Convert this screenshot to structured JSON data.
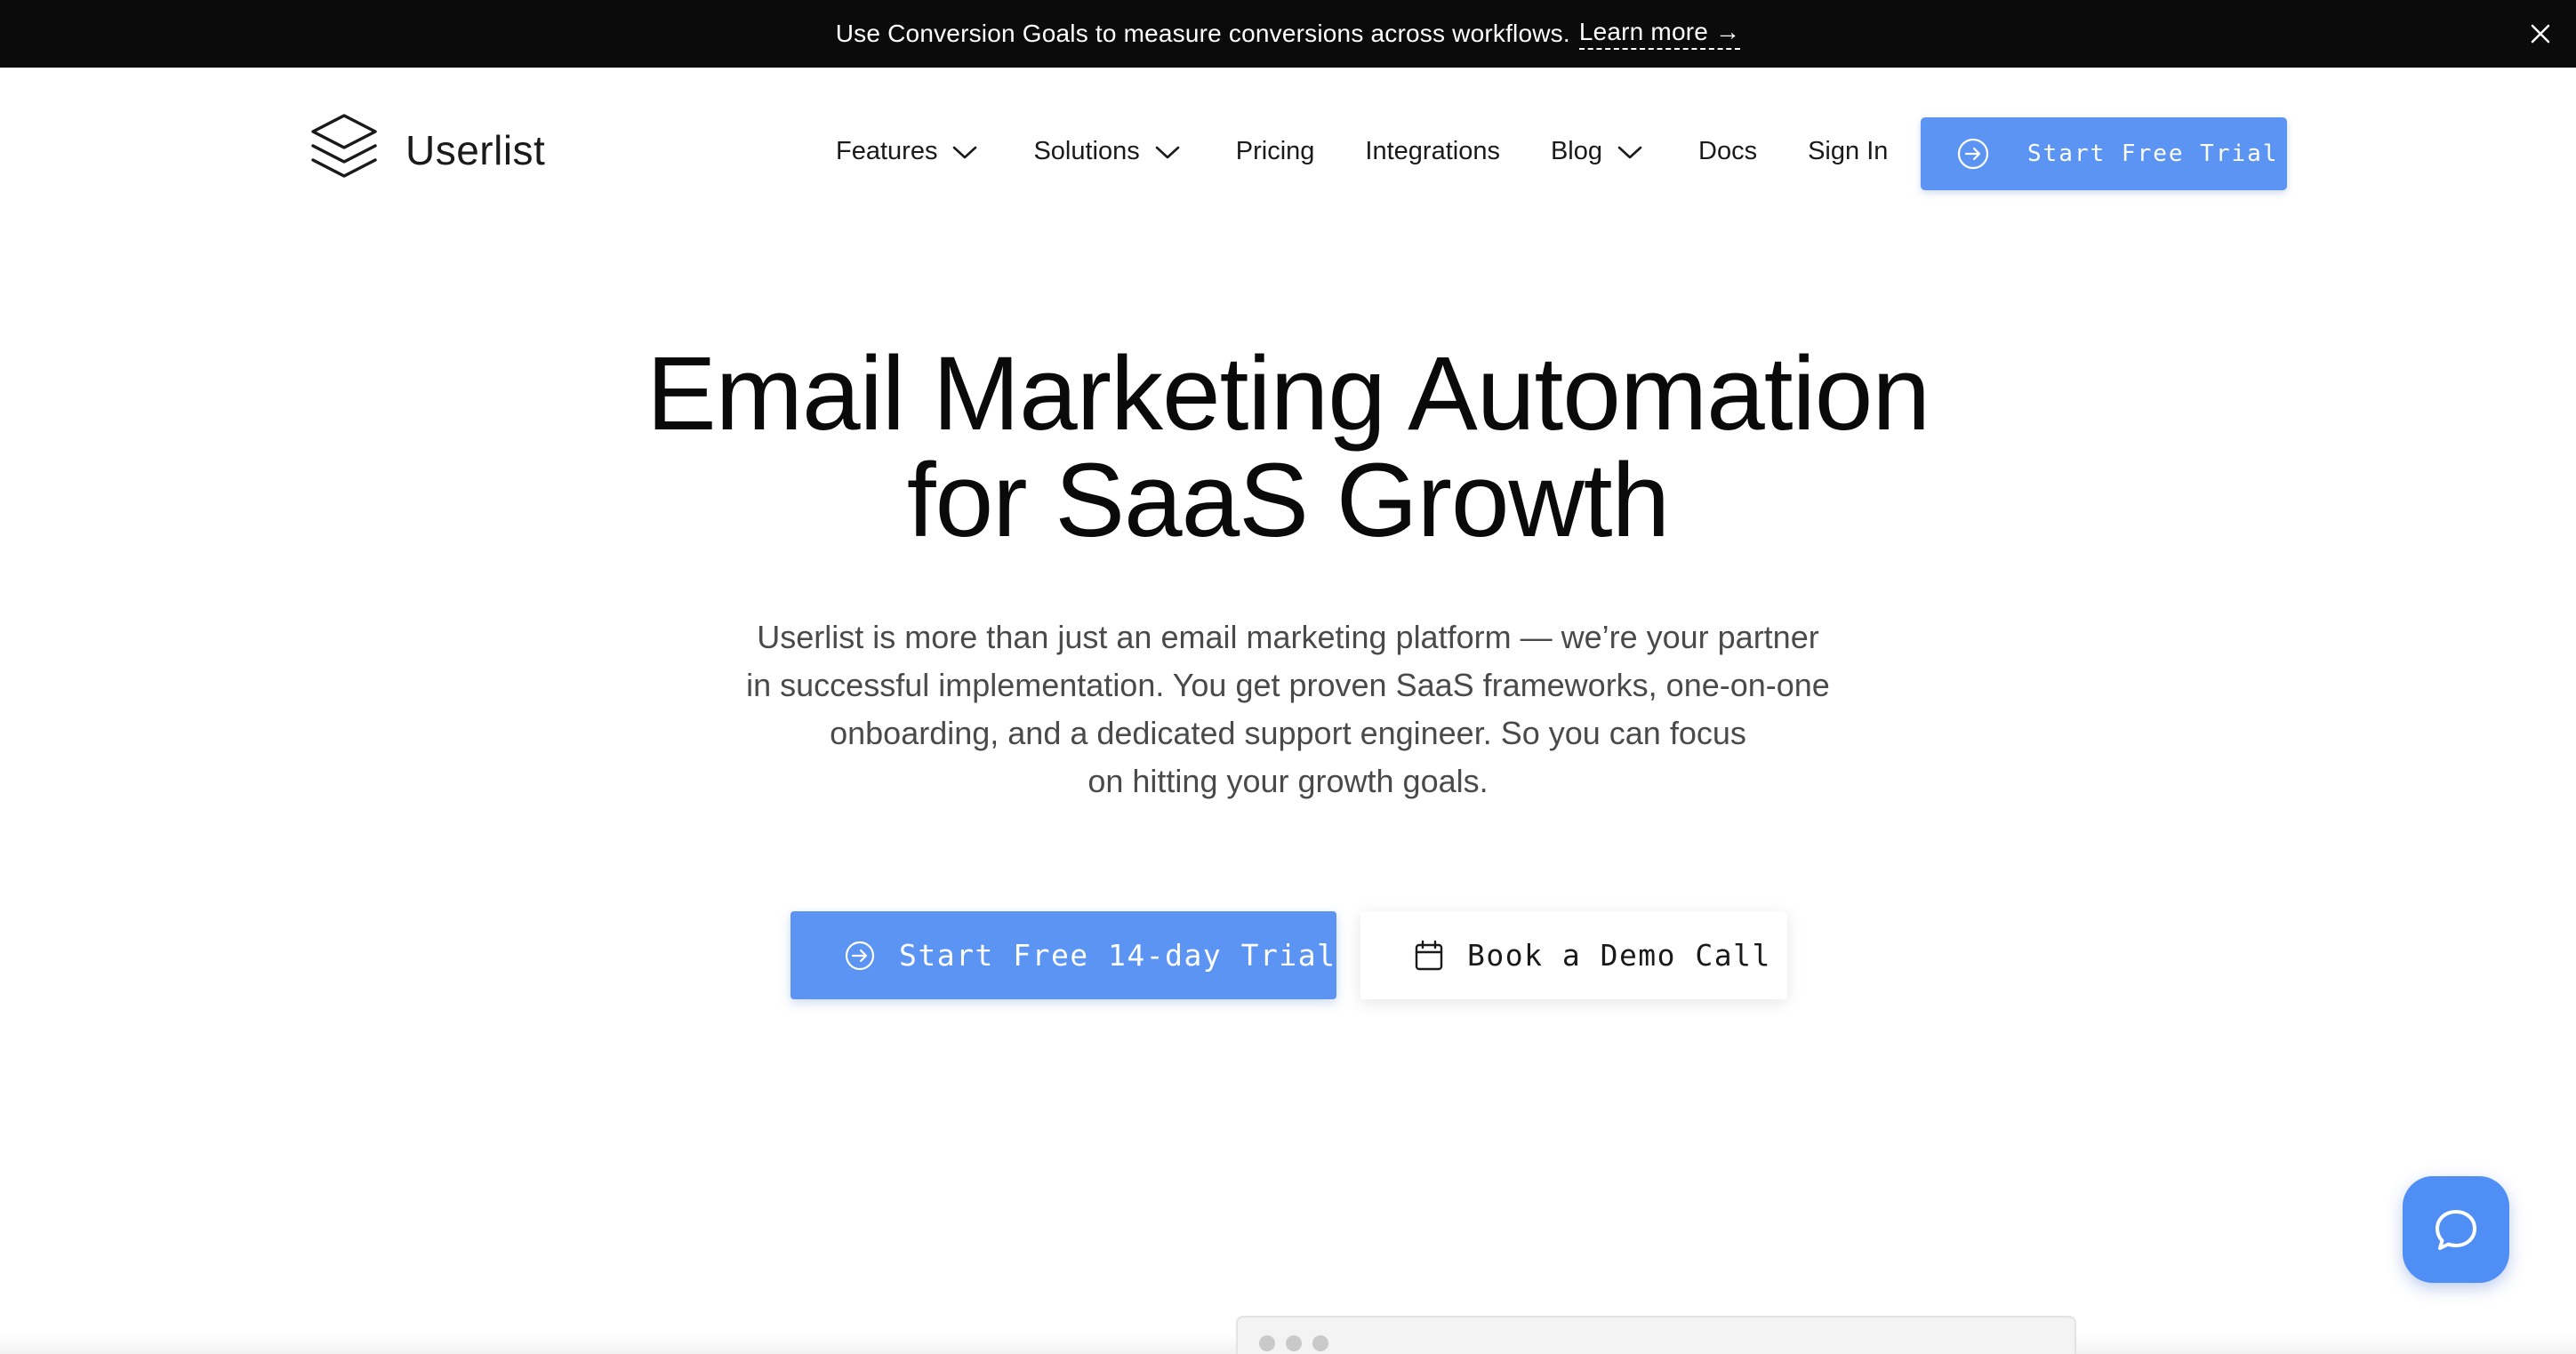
{
  "announcement": {
    "message": "Use Conversion Goals to measure conversions across workflows.",
    "link_label": "Learn more →",
    "close_icon": "close-icon"
  },
  "header": {
    "brand": "Userlist",
    "logo_icon": "layers-icon",
    "nav": [
      {
        "label": "Features",
        "has_dropdown": true
      },
      {
        "label": "Solutions",
        "has_dropdown": true
      },
      {
        "label": "Pricing",
        "has_dropdown": false
      },
      {
        "label": "Integrations",
        "has_dropdown": false
      },
      {
        "label": "Blog",
        "has_dropdown": true
      },
      {
        "label": "Docs",
        "has_dropdown": false
      },
      {
        "label": "Sign In",
        "has_dropdown": false
      }
    ],
    "cta_label": "Start Free Trial"
  },
  "hero": {
    "title_lines": [
      "Email Marketing Automation",
      "for SaaS Growth"
    ],
    "subtitle_lines": [
      "Userlist is more than just an email marketing platform — we’re your partner",
      "in successful implementation. You get proven SaaS frameworks, one-on-one",
      "onboarding, and a dedicated support engineer. So you can focus",
      "on hitting your growth goals."
    ],
    "primary_cta": "Start Free 14-day Trial",
    "secondary_cta": "Book a Demo Call"
  },
  "colors": {
    "accent": "#5b94f2",
    "announce_bg": "#0b0b0b",
    "chat": "#4f8ef5"
  }
}
